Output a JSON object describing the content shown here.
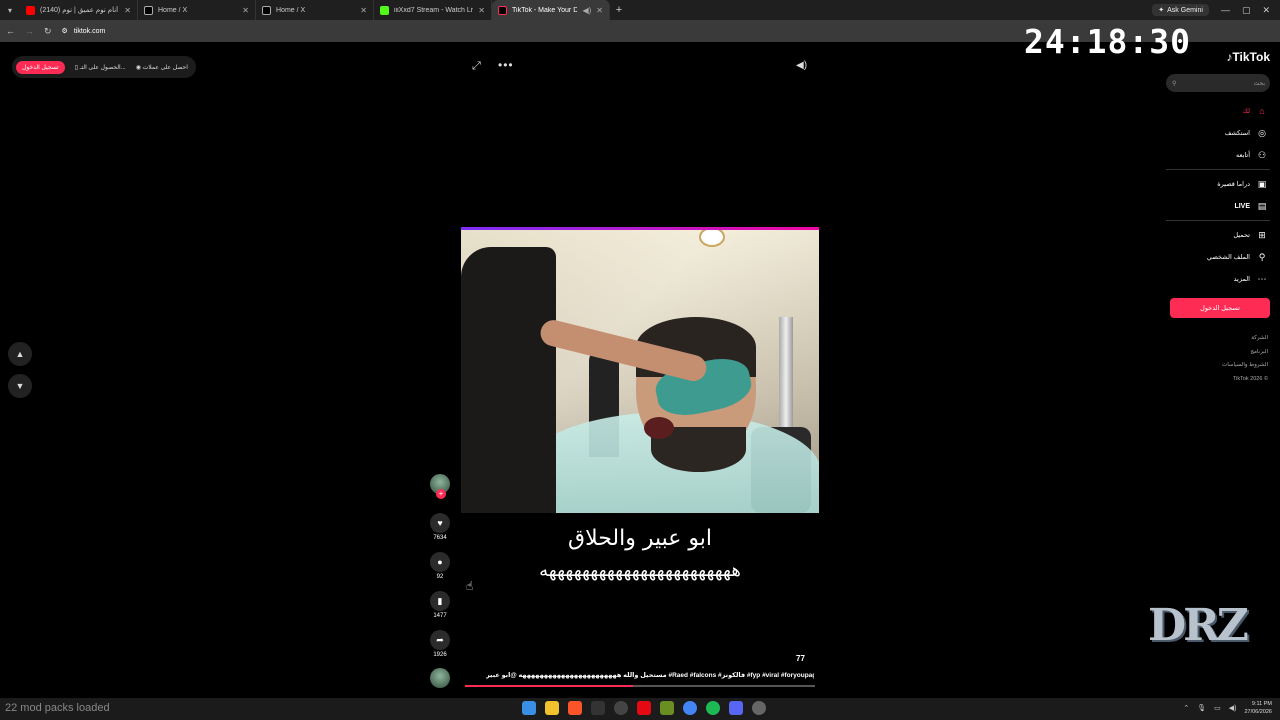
{
  "browser": {
    "tabs": [
      {
        "title": "(2140) كيف أنام نوم عميق | نوم...",
        "color": "#ff0000",
        "active": false
      },
      {
        "title": "Home / X",
        "color": "#ffffff",
        "active": false
      },
      {
        "title": "Home / X",
        "color": "#ffffff",
        "active": false
      },
      {
        "title": "iiiXxd7 Stream - Watch Live on ...",
        "color": "#53fc18",
        "active": false
      },
      {
        "title": "TikTok - Make Your Day",
        "color": "#ffffff",
        "active": true
      }
    ],
    "new_tab": "+",
    "gemini_label": "Ask Gemini",
    "url": "tiktok.com"
  },
  "overlay": {
    "clock": "24:18:30",
    "watermark": "DRZ"
  },
  "topbar": {
    "signup": "تسجيل الدخول",
    "get_app": "الحصول على التـ...",
    "get_coins": "احصل على عملات"
  },
  "video": {
    "caption_line1": "ابو عبير والحلاق",
    "caption_line2": "هههههههههههههههههههههههه",
    "views": "77",
    "description": "مستحيل والله هههههههههههههههههههههههه @ابو عبير #Raed #falcons #فالكونز #fyp #viral #foryoupage",
    "progress": 0.48
  },
  "actions": {
    "likes": "7634",
    "comments": "92",
    "saves": "1477",
    "shares": "1926"
  },
  "sidebar": {
    "logo": "TikTok",
    "search_placeholder": "بحث",
    "nav": [
      {
        "label": "لك",
        "icon": "home-icon",
        "glyph": "⌂",
        "active": true
      },
      {
        "label": "استكشف",
        "icon": "compass-icon",
        "glyph": "◎",
        "active": false
      },
      {
        "label": "أتابعه",
        "icon": "following-icon",
        "glyph": "⚇",
        "active": false
      }
    ],
    "nav2": [
      {
        "label": "دراما قصيرة",
        "icon": "drama-icon",
        "glyph": "▣"
      },
      {
        "label": "LIVE",
        "icon": "live-icon",
        "glyph": "▤"
      }
    ],
    "nav3": [
      {
        "label": "تحميل",
        "icon": "upload-icon",
        "glyph": "⊞"
      },
      {
        "label": "الملف الشخصي",
        "icon": "profile-icon",
        "glyph": "⚲"
      },
      {
        "label": "المزيد",
        "icon": "more-icon",
        "glyph": "⋯"
      }
    ],
    "signup_button": "تسجيل الدخول",
    "footer": [
      "الشركة",
      "البرنامج",
      "الشروط والسياسات",
      "TikTok 2026 ©"
    ]
  },
  "taskbar": {
    "status_text": "22 mod packs loaded",
    "time": "9:11 PM",
    "date": "27/06/2026"
  },
  "colors": {
    "accent": "#fe2c55",
    "background": "#000000"
  }
}
